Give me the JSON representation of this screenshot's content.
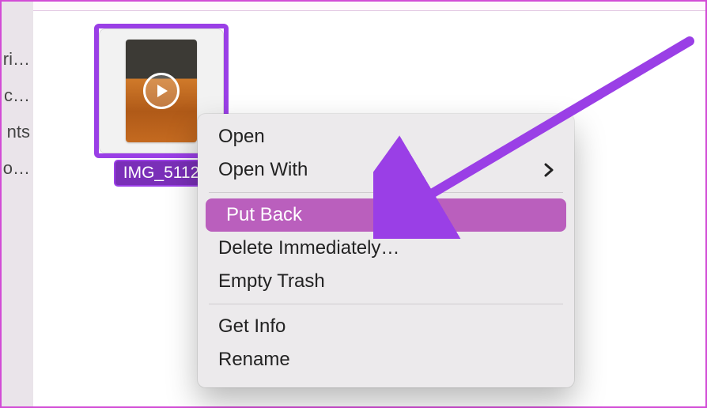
{
  "sidebar": {
    "items": [
      {
        "label": "ri…"
      },
      {
        "label": "c…"
      },
      {
        "label": "nts"
      },
      {
        "label": "o…"
      }
    ]
  },
  "file": {
    "name": "IMG_5112",
    "icon": "video-play-icon"
  },
  "context_menu": {
    "open": "Open",
    "open_with": "Open With",
    "put_back": "Put Back",
    "delete_immediately": "Delete Immediately…",
    "empty_trash": "Empty Trash",
    "get_info": "Get Info",
    "rename": "Rename"
  },
  "highlight_color": "#ba5fbd",
  "arrow_color": "#9a3fe6"
}
